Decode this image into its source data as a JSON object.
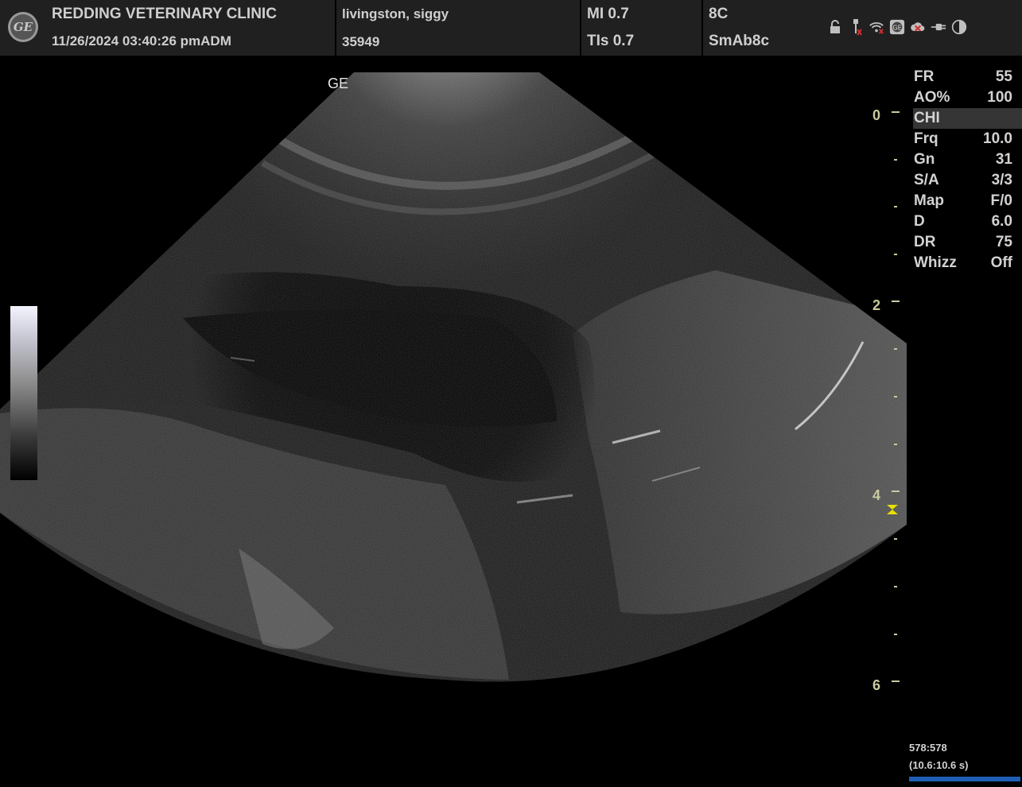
{
  "header": {
    "clinic_name": "REDDING VETERINARY CLINIC",
    "datetime": "11/26/2024 03:40:26 pm",
    "operator": "ADM",
    "patient_name": "livingston, siggy",
    "patient_id": "35949",
    "mi": "MI 0.7",
    "tis": "TIs 0.7",
    "probe": "8C",
    "preset": "SmAb8c",
    "logo_text": "GE"
  },
  "status_icons": [
    "lock-icon",
    "usb-icon",
    "wifi-icon",
    "ge-service-icon",
    "cloud-error-icon",
    "power-plug-icon",
    "contrast-icon"
  ],
  "image": {
    "orientation_mark": "GE"
  },
  "depth_scale": {
    "labels": [
      "0",
      "2",
      "4",
      "6"
    ],
    "color": "#c9c9a0"
  },
  "parameters": [
    {
      "label": "FR",
      "value": "55"
    },
    {
      "label": "AO%",
      "value": "100"
    },
    {
      "label": "CHI",
      "value": ""
    },
    {
      "label": "Frq",
      "value": "10.0"
    },
    {
      "label": "Gn",
      "value": "31"
    },
    {
      "label": "S/A",
      "value": "3/3"
    },
    {
      "label": "Map",
      "value": "F/0"
    },
    {
      "label": "D",
      "value": "6.0"
    },
    {
      "label": "DR",
      "value": "75"
    },
    {
      "label": "Whizz",
      "value": "Off"
    }
  ],
  "cine": {
    "frame": "578:578",
    "time": "(10.6:10.6 s)",
    "progress": 1.0,
    "color": "#1e5fb6"
  },
  "colors": {
    "header_bg": "#202020",
    "focus_marker": "#e8e000"
  }
}
